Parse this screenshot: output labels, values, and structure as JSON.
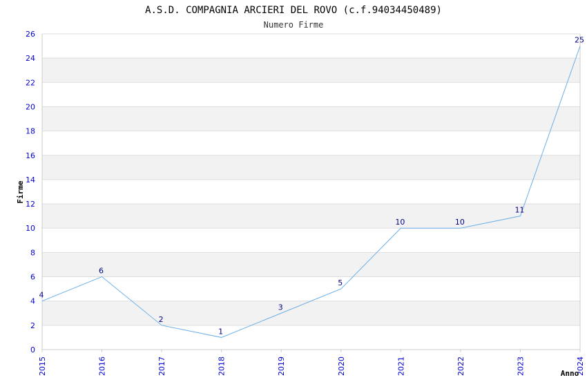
{
  "chart_data": {
    "type": "line",
    "title": "A.S.D. COMPAGNIA ARCIERI DEL ROVO (c.f.94034450489)",
    "subtitle": "Numero Firme",
    "xlabel": "Anno",
    "ylabel": "Firme",
    "categories": [
      "2015",
      "2016",
      "2017",
      "2018",
      "2019",
      "2020",
      "2021",
      "2022",
      "2023",
      "2024"
    ],
    "values": [
      4,
      6,
      2,
      1,
      3,
      5,
      10,
      10,
      11,
      25
    ],
    "ylim": [
      0,
      26
    ],
    "yticks": [
      0,
      2,
      4,
      6,
      8,
      10,
      12,
      14,
      16,
      18,
      20,
      22,
      24,
      26
    ],
    "grid": true,
    "banded_background": true
  },
  "colors": {
    "line": "#6aaee8",
    "tick_labels": "#0000cc",
    "data_labels": "#000080",
    "band": "#f2f2f2",
    "gridline": "#dddddd",
    "axis": "#cccccc"
  }
}
